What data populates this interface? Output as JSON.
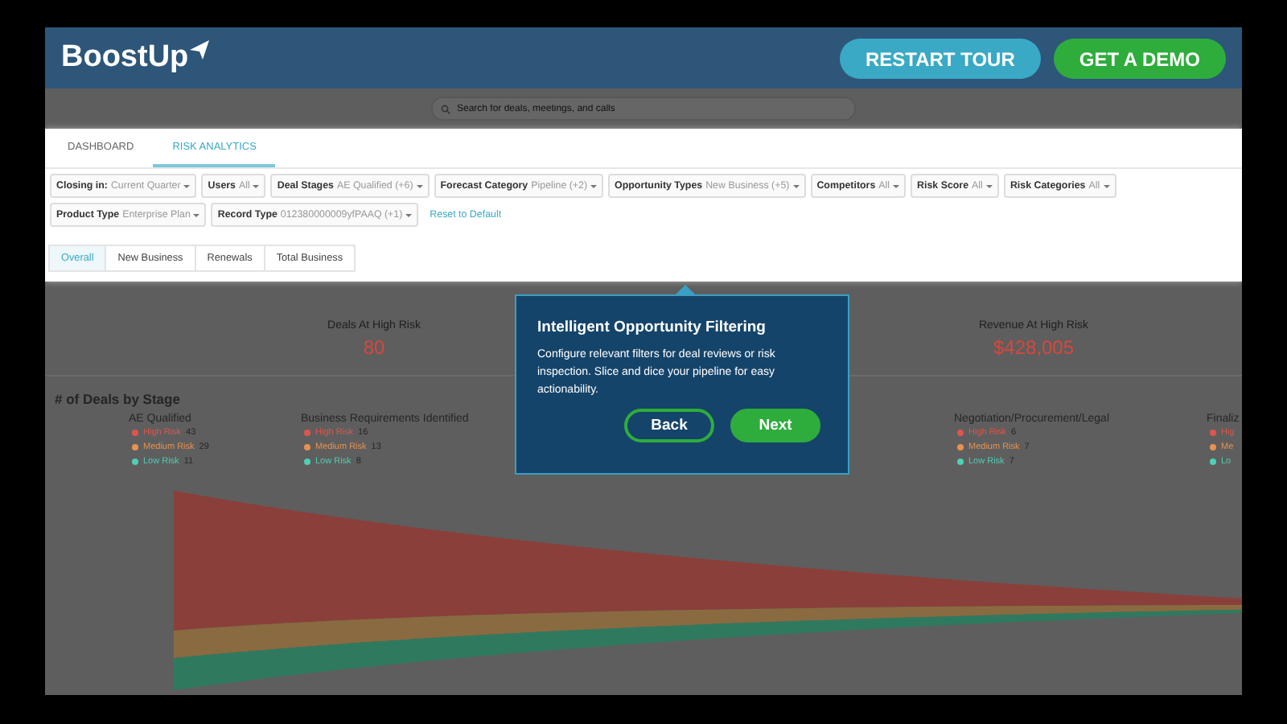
{
  "header": {
    "logo": "BoostUp",
    "buttons": [
      {
        "label": "RESTART TOUR",
        "kind": "secondary"
      },
      {
        "label": "GET A DEMO",
        "kind": "primary"
      }
    ]
  },
  "search": {
    "placeholder": "Search for deals, meetings, and calls"
  },
  "tabs": [
    {
      "label": "DASHBOARD",
      "selected": false
    },
    {
      "label": "RISK ANALYTICS",
      "selected": true
    }
  ],
  "filter_rows": [
    {
      "chips": [
        {
          "label": "Closing in:",
          "value": "Current Quarter"
        },
        {
          "label": "Users",
          "value": "All"
        },
        {
          "label": "Deal Stages",
          "value": "AE Qualified (+6)"
        },
        {
          "label": "Forecast Category",
          "value": "Pipeline (+2)"
        },
        {
          "label": "Opportunity Types",
          "value": "New Business (+5)"
        },
        {
          "label": "Competitors",
          "value": "All"
        },
        {
          "label": "Risk Score",
          "value": "All"
        },
        {
          "label": "Risk Categories",
          "value": "All"
        }
      ]
    },
    {
      "chips": [
        {
          "label": "Product Type",
          "value": "Enterprise Plan"
        },
        {
          "label": "Record Type",
          "value": "012380000009yfPAAQ (+1)"
        }
      ],
      "link": "Reset to Default"
    }
  ],
  "sub_tabs": [
    {
      "label": "Overall",
      "selected": true
    },
    {
      "label": "New Business",
      "selected": false
    },
    {
      "label": "Renewals",
      "selected": false
    },
    {
      "label": "Total Business",
      "selected": false
    }
  ],
  "metrics": [
    {
      "label": "Deals At High Risk",
      "value": "80"
    },
    {
      "label": "Revenue At High Risk",
      "value": "$428,005"
    }
  ],
  "stages_title": "# of Deals by Stage",
  "stages": [
    {
      "name": "AE Qualified",
      "legend": [
        {
          "label": "High Risk",
          "count": "43",
          "color": "#e0554b"
        },
        {
          "label": "Medium Risk",
          "count": "29",
          "color": "#e8924f"
        },
        {
          "label": "Low Risk",
          "count": "11",
          "color": "#4fd0b4"
        }
      ]
    },
    {
      "name": "Business Requirements Identified",
      "legend": [
        {
          "label": "High Risk",
          "count": "16",
          "color": "#e0554b"
        },
        {
          "label": "Medium Risk",
          "count": "13",
          "color": "#e8924f"
        },
        {
          "label": "Low Risk",
          "count": "8",
          "color": "#4fd0b4"
        }
      ]
    },
    {
      "name": "Negotiation/Procurement/Legal",
      "legend": [
        {
          "label": "High Risk",
          "count": "6",
          "color": "#e0554b"
        },
        {
          "label": "Medium Risk",
          "count": "7",
          "color": "#e8924f"
        },
        {
          "label": "Low Risk",
          "count": "7",
          "color": "#4fd0b4"
        }
      ]
    },
    {
      "name": "Finaliz",
      "legend": [
        {
          "label": "Hig",
          "color": "#e0554b"
        },
        {
          "label": "Me",
          "color": "#e8924f"
        },
        {
          "label": "Lo",
          "color": "#4fd0b4"
        }
      ]
    }
  ],
  "tour": {
    "title": "Intelligent Opportunity Filtering",
    "text": "Configure relevant filters for deal reviews or risk inspection. Slice and dice your pipeline for easy actionability.",
    "buttons": [
      {
        "label": "Back",
        "kind": "outline"
      },
      {
        "label": "Next",
        "kind": "filled"
      }
    ]
  }
}
